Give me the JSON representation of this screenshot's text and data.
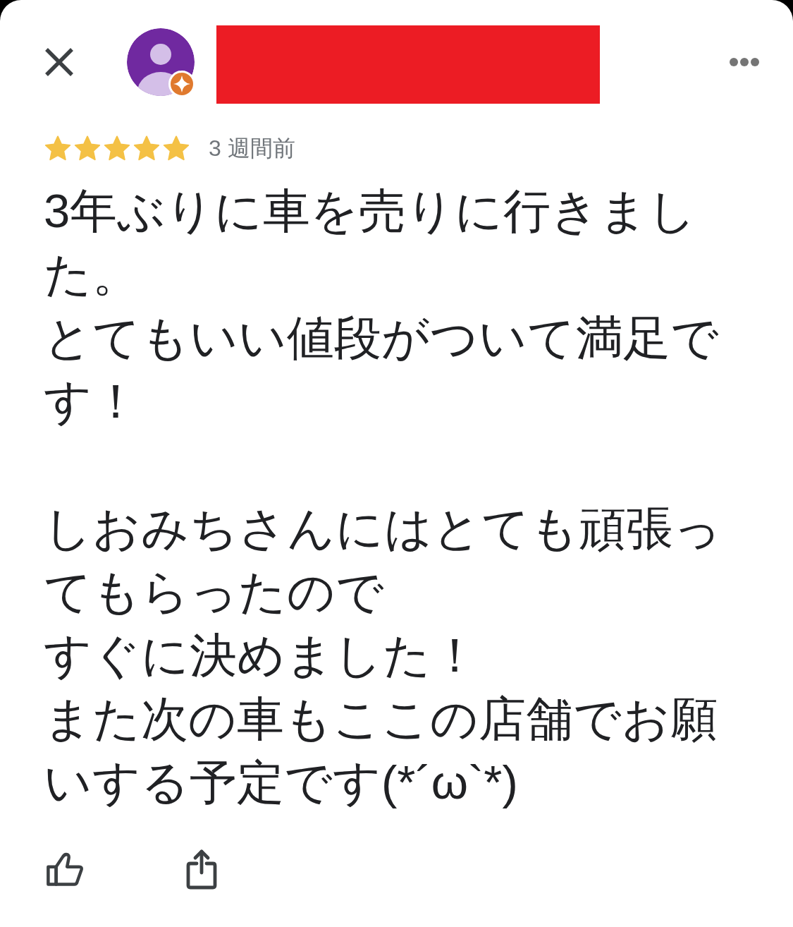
{
  "review": {
    "stars": 5,
    "time": "3 週間前",
    "paragraphs": [
      [
        "3年ぶりに車を売りに行きました。",
        "とてもいい値段がついて満足です！"
      ],
      [
        "しおみちさんにはとても頑張ってもらったので",
        "すぐに決めました！",
        "また次の車もここの店舗でお願いする予定です(*´ω`*)"
      ]
    ]
  }
}
